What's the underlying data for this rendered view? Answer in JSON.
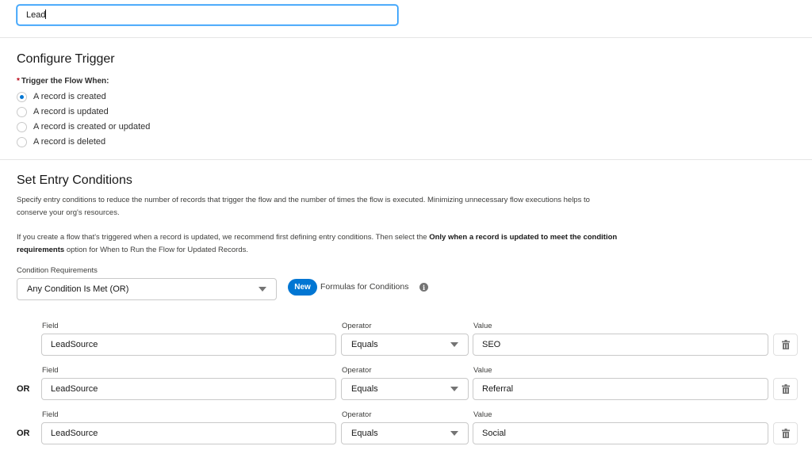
{
  "object_field": {
    "value": "Lead"
  },
  "configure_trigger": {
    "title": "Configure Trigger",
    "required_marker": "*",
    "label": "Trigger the Flow When:",
    "options": [
      {
        "label": "A record is created",
        "checked": true
      },
      {
        "label": "A record is updated",
        "checked": false
      },
      {
        "label": "A record is created or updated",
        "checked": false
      },
      {
        "label": "A record is deleted",
        "checked": false
      }
    ]
  },
  "entry_conditions": {
    "title": "Set Entry Conditions",
    "description_1": "Specify entry conditions to reduce the number of records that trigger the flow and the number of times the flow is executed. Minimizing unnecessary flow executions helps to conserve your org's resources.",
    "description_2_prefix": "If you create a flow that's triggered when a record is updated, we recommend first defining entry conditions. Then select the ",
    "description_2_bold": "Only when a record is updated to meet the condition requirements",
    "description_2_suffix": " option for When to Run the Flow for Updated Records.",
    "condition_requirements_label": "Condition Requirements",
    "condition_requirements_value": "Any Condition Is Met (OR)",
    "new_badge": "New",
    "formulas_label": "Formulas for Conditions",
    "info_icon": "i",
    "field_label": "Field",
    "operator_label": "Operator",
    "value_label": "Value",
    "conditions": [
      {
        "connector": "",
        "field": "LeadSource",
        "operator": "Equals",
        "value": "SEO"
      },
      {
        "connector": "OR",
        "field": "LeadSource",
        "operator": "Equals",
        "value": "Referral"
      },
      {
        "connector": "OR",
        "field": "LeadSource",
        "operator": "Equals",
        "value": "Social"
      }
    ]
  },
  "colors": {
    "brand_blue": "#0176d3",
    "focus_border": "#1b96ff",
    "required_red": "#ba0517"
  }
}
